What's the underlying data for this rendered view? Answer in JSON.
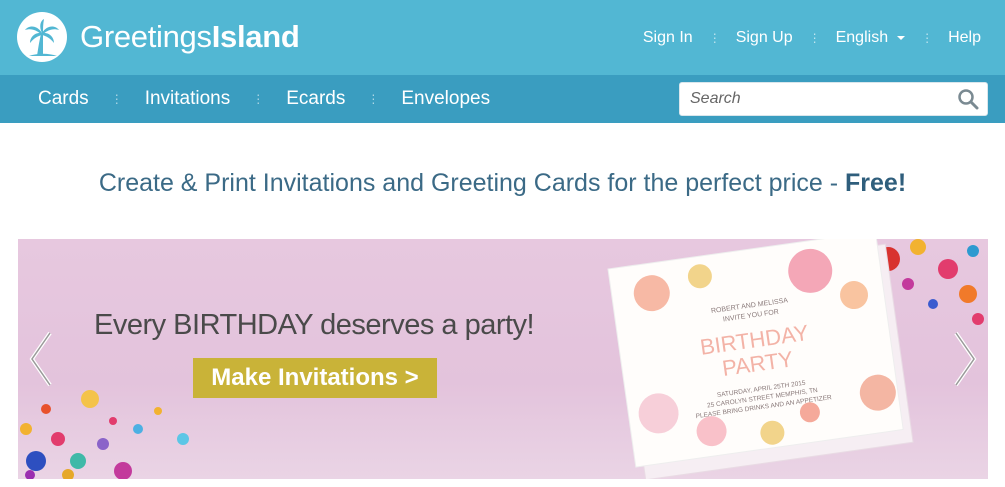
{
  "brand": {
    "name_light": "Greetings",
    "name_bold": "Island"
  },
  "top_links": {
    "sign_in": "Sign In",
    "sign_up": "Sign Up",
    "language": "English",
    "help": "Help",
    "separator": "⋮"
  },
  "nav": {
    "items": [
      "Cards",
      "Invitations",
      "Ecards",
      "Envelopes"
    ],
    "separator": "⋮"
  },
  "search": {
    "placeholder": "Search"
  },
  "headline": {
    "text": "Create & Print Invitations and Greeting Cards for the perfect price - ",
    "emphasis": "Free!"
  },
  "banner": {
    "tagline": "Every BIRTHDAY deserves a party!",
    "cta_label": "Make Invitations >",
    "card": {
      "top_line1": "ROBERT AND MELISSA",
      "top_line2": "INVITE YOU FOR",
      "title1": "BIRTHDAY",
      "title2": "PARTY",
      "detail1": "SATURDAY, APRIL 25TH 2015",
      "detail2": "25 CAROLYN STREET MEMPHIS, TN",
      "detail3": "PLEASE BRING DRINKS AND AN APPETIZER"
    }
  },
  "colors": {
    "topbar": "#52b7d3",
    "navbar": "#3a9dc0",
    "headline": "#3b6a86",
    "cta": "#c9b338",
    "banner_bg": "#e7c8df"
  }
}
